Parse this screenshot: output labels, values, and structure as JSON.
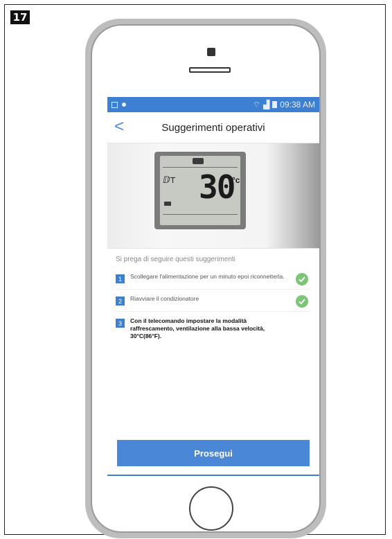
{
  "figure": {
    "step_number": "17"
  },
  "statusbar": {
    "left_icons": [
      "save-icon",
      "notification-icon"
    ],
    "right_icons": [
      "wifi-icon",
      "signal-icon",
      "battery-icon"
    ],
    "time": "09:38 AM"
  },
  "nav": {
    "back_label": "<",
    "title": "Suggerimenti operativi"
  },
  "device_display": {
    "temperature": "30",
    "unit": "°c",
    "mode_symbols": "ⅅ⊤"
  },
  "content": {
    "intro": "Si prega di seguire questi suggerimenti",
    "steps": [
      {
        "number": "1",
        "text": "Scollegare l'alimentazione per un minuto epoi riconnetterla.",
        "checked": true
      },
      {
        "number": "2",
        "text": "Riavviare il condizionatore",
        "checked": true
      },
      {
        "number": "3",
        "text": "Con il telecomando impostare la modalità raffrescamento, ventilazione alla bassa velocità, 30°C(86°F).",
        "checked": false
      }
    ]
  },
  "actions": {
    "continue_label": "Prosegui"
  },
  "colors": {
    "accent": "#3d7fd0",
    "button": "#4a87d6",
    "check": "#7cc577"
  }
}
